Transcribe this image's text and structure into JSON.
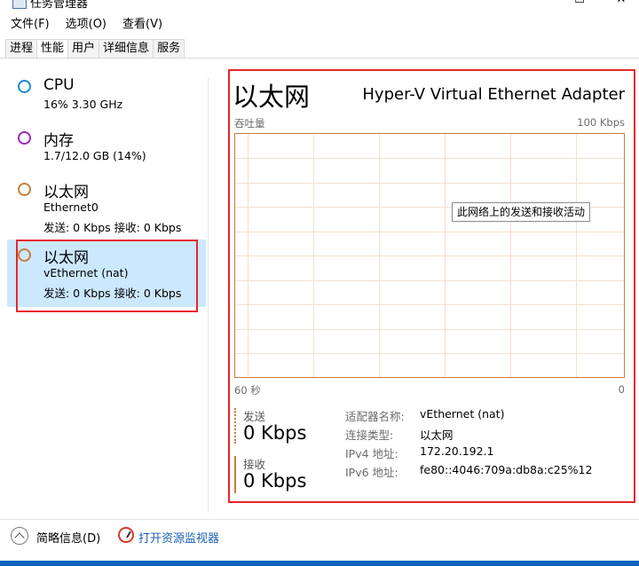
{
  "window": {
    "title": "任务管理器",
    "controls": {
      "minimize": "—",
      "maximize": "☐",
      "close": "✕"
    }
  },
  "menu": [
    "文件(F)",
    "选项(O)",
    "查看(V)"
  ],
  "tabs": [
    {
      "label": "进程",
      "active": false
    },
    {
      "label": "性能",
      "active": true
    },
    {
      "label": "用户",
      "active": false
    },
    {
      "label": "详细信息",
      "active": false
    },
    {
      "label": "服务",
      "active": false
    }
  ],
  "sidebar": [
    {
      "name": "CPU",
      "line1": "16% 3.30 GHz",
      "line2": "",
      "color": "#1a8ad4",
      "selected": false
    },
    {
      "name": "内存",
      "line1": "1.7/12.0 GB (14%)",
      "line2": "",
      "color": "#9a28b8",
      "selected": false
    },
    {
      "name": "以太网",
      "line1": "Ethernet0",
      "line2": "发送: 0 Kbps 接收: 0 Kbps",
      "color": "#c77f3b",
      "selected": false
    },
    {
      "name": "以太网",
      "line1": "vEthernet (nat)",
      "line2": "发送: 0 Kbps 接收: 0 Kbps",
      "color": "#c77f3b",
      "selected": true
    }
  ],
  "detail": {
    "title": "以太网",
    "adapter": "Hyper-V Virtual Ethernet Adapter",
    "graph_label": "吞吐量",
    "graph_max": "100 Kbps",
    "time_left": "60 秒",
    "time_right": "0",
    "tooltip": "此网络上的发送和接收活动",
    "graph_color": "#c77f3b",
    "send_label": "发送",
    "send_value": "0 Kbps",
    "recv_label": "接收",
    "recv_value": "0 Kbps",
    "properties": [
      {
        "key": "适配器名称:",
        "value": "vEthernet (nat)"
      },
      {
        "key": "连接类型:",
        "value": "以太网"
      },
      {
        "key": "IPv4 地址:",
        "value": "172.20.192.1"
      },
      {
        "key": "IPv6 地址:",
        "value": "fe80::4046:709a:db8a:c25%12"
      }
    ]
  },
  "footer": {
    "fewer_details": "简略信息(D)",
    "resource_monitor": "打开资源监视器"
  },
  "accent_colors": {
    "highlight_red": "#e8262d",
    "selected_bg": "#cce8ff",
    "link_blue": "#1a5fb4"
  }
}
